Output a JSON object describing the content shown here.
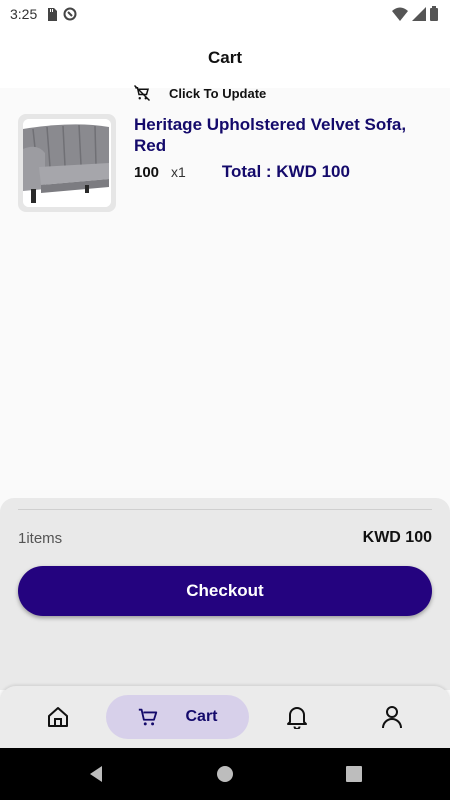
{
  "status_bar": {
    "time": "3:25"
  },
  "header": {
    "title": "Cart"
  },
  "cart": {
    "items": [
      {
        "name": "Heritage Upholstered Velvet Sofa, Red",
        "unit_price": "100",
        "quantity": "x1",
        "total": "Total : KWD 100",
        "update_label": "Click To Update"
      }
    ]
  },
  "summary": {
    "items_count": "1items",
    "total": "KWD 100",
    "checkout_label": "Checkout"
  },
  "bottom_nav": {
    "items": [
      {
        "icon": "home-icon",
        "label": ""
      },
      {
        "icon": "cart-icon",
        "label": "Cart",
        "active": true
      },
      {
        "icon": "bell-icon",
        "label": ""
      },
      {
        "icon": "user-icon",
        "label": ""
      }
    ]
  },
  "colors": {
    "brand": "#24037f",
    "title_text": "#140a6b",
    "active_nav_bg": "#d7d0ea"
  }
}
